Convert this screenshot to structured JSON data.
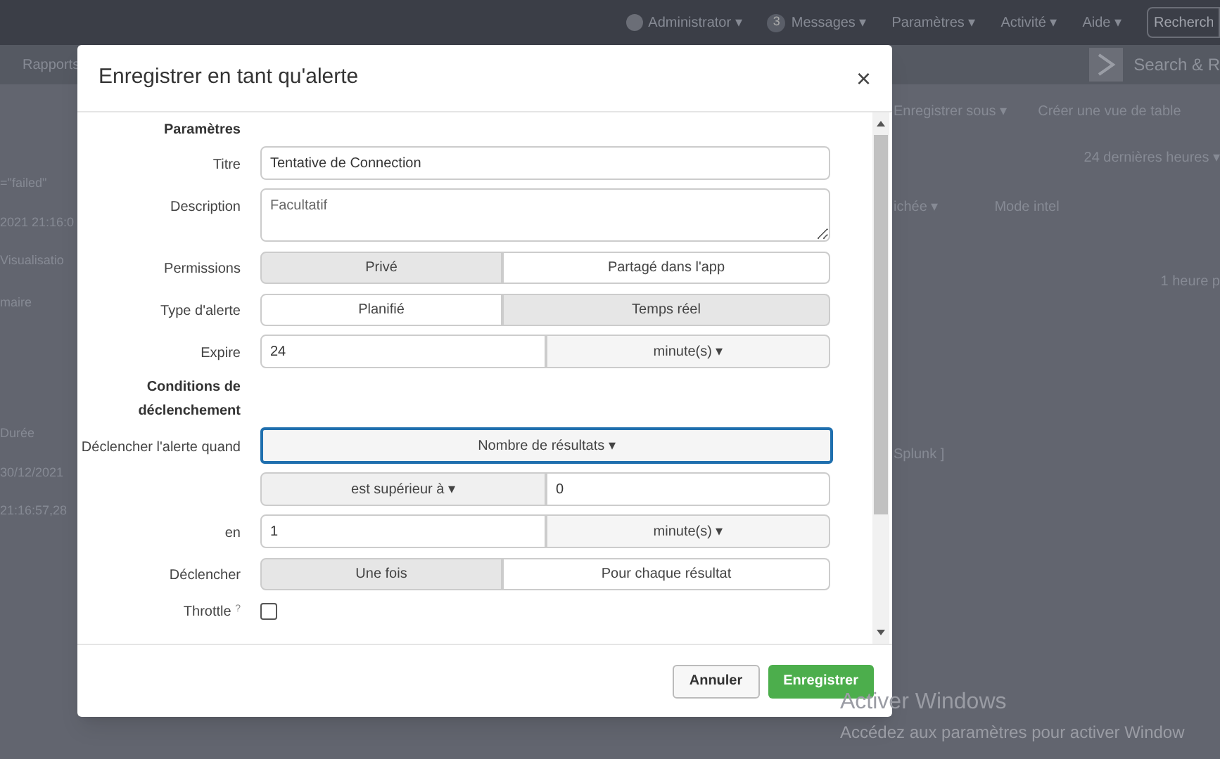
{
  "top_nav": [
    {
      "label": "Administrator ▾",
      "kind": "user"
    },
    {
      "label": "Messages ▾",
      "kind": "messages",
      "badge": "3"
    },
    {
      "label": "Paramètres ▾",
      "kind": "plain"
    },
    {
      "label": "Activité ▾",
      "kind": "plain"
    },
    {
      "label": "Aide ▾",
      "kind": "plain"
    }
  ],
  "search_field": {
    "value": "Recherch"
  },
  "app_bar": {
    "left": "Rapports",
    "right": "Search & R"
  },
  "left_fragments": [
    "=\"failed\"",
    "2021 21:16:0",
    "Visualisatio",
    "maire",
    "Durée",
    "30/12/2021",
    "21:16:57,28"
  ],
  "right_panel": {
    "actions": [
      "Enregistrer sous ▾",
      "Créer une vue de table"
    ],
    "time_picker": "24 dernières heures ▾",
    "format": "ichée ▾",
    "mode": "Mode intel",
    "timeline": "1 heure p",
    "event": "Splunk ]"
  },
  "dialog": {
    "title": "Enregistrer en tant qu'alerte",
    "close": "×",
    "rows": [
      {
        "kind": "heading",
        "label": "Paramètres"
      },
      {
        "kind": "text",
        "label": "Titre",
        "value": "Tentative de Connection"
      },
      {
        "kind": "textarea",
        "label": "Description",
        "placeholder": "Facultatif"
      },
      {
        "kind": "segmented",
        "label": "Permissions",
        "options": [
          {
            "label": "Privé",
            "selected": true
          },
          {
            "label": "Partagé dans l'app",
            "selected": false
          }
        ]
      },
      {
        "kind": "segmented",
        "label": "Type d'alerte",
        "options": [
          {
            "label": "Planifié",
            "selected": false
          },
          {
            "label": "Temps réel",
            "selected": true
          }
        ]
      },
      {
        "kind": "unit",
        "label": "Expire",
        "value": "24",
        "unit": "minute(s) ▾"
      },
      {
        "kind": "heading",
        "label": "Conditions de déclenchement"
      },
      {
        "kind": "dropdown",
        "label": "Déclencher l'alerte quand",
        "value": "Nombre de résultats ▾"
      },
      {
        "kind": "compare",
        "operator": "est supérieur à ▾",
        "value": "0"
      },
      {
        "kind": "unit",
        "label": "en",
        "value": "1",
        "unit": "minute(s) ▾"
      },
      {
        "kind": "segmented",
        "label": "Déclencher",
        "options": [
          {
            "label": "Une fois",
            "selected": true
          },
          {
            "label": "Pour chaque résultat",
            "selected": false
          }
        ]
      },
      {
        "kind": "checkbox",
        "label": "Throttle",
        "help": "?",
        "checked": false
      }
    ],
    "buttons": [
      {
        "label": "Annuler",
        "kind": "secondary"
      },
      {
        "label": "Enregistrer",
        "kind": "primary"
      }
    ]
  },
  "os_notice": {
    "title": "Activer Windows",
    "text": "Accédez aux paramètres pour activer Window"
  }
}
